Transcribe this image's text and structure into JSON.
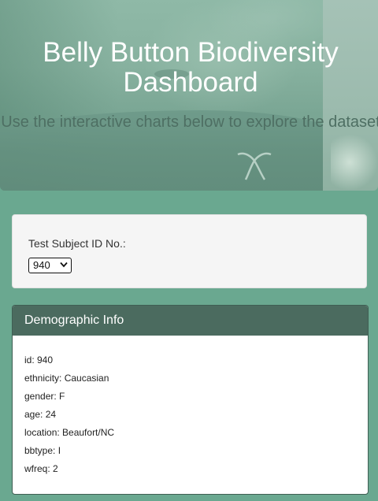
{
  "header": {
    "title": "Belly Button Biodiversity Dashboard",
    "subtitle": "Use the interactive charts below to explore the dataset"
  },
  "selector": {
    "label": "Test Subject ID No.:",
    "selected_value": "940"
  },
  "demographics": {
    "heading": "Demographic Info",
    "rows": [
      "id: 940",
      "ethnicity: Caucasian",
      "gender: F",
      "age: 24",
      "location: Beaufort/NC",
      "bbtype: I",
      "wfreq: 2"
    ]
  },
  "colors": {
    "page_background": "#6aa890",
    "panel_heading": "#4b6b5f",
    "title_text": "#ffffff",
    "subtitle_text": "#4e6f63"
  }
}
